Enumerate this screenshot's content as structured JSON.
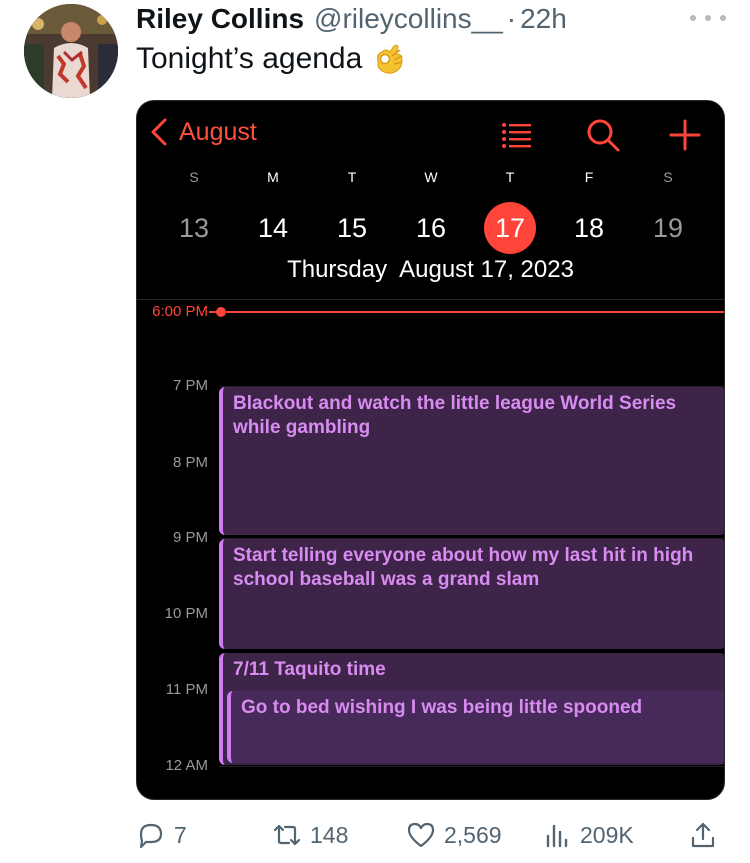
{
  "tweet": {
    "display_name": "Riley Collins",
    "handle": "@rileycollins__",
    "separator": "·",
    "time": "22h",
    "text": "Tonight’s agenda",
    "emoji": "ok-hand-emoji"
  },
  "calendar": {
    "back_label": "August",
    "accent_color": "#ff453a",
    "event_color": "#3e2448",
    "event_text_color": "#d88bf0",
    "weekdays": [
      "S",
      "M",
      "T",
      "W",
      "T",
      "F",
      "S"
    ],
    "dates": [
      "13",
      "14",
      "15",
      "16",
      "17",
      "18",
      "19"
    ],
    "selected_date": "17",
    "full_date": "Thursday  August 17, 2023",
    "current_time": "6:00 PM",
    "hours": [
      "7 PM",
      "8 PM",
      "9 PM",
      "10 PM",
      "11 PM",
      "12 AM"
    ],
    "events": [
      {
        "title": "Blackout and watch the little league World Series while gambling"
      },
      {
        "title": "Start telling everyone about how my last hit in high school baseball was a grand slam"
      },
      {
        "title": "7/11 Taquito time"
      },
      {
        "title": "Go to bed wishing I was being little spooned"
      }
    ]
  },
  "actions": {
    "replies": "7",
    "retweets": "148",
    "likes": "2,569",
    "views": "209K"
  }
}
